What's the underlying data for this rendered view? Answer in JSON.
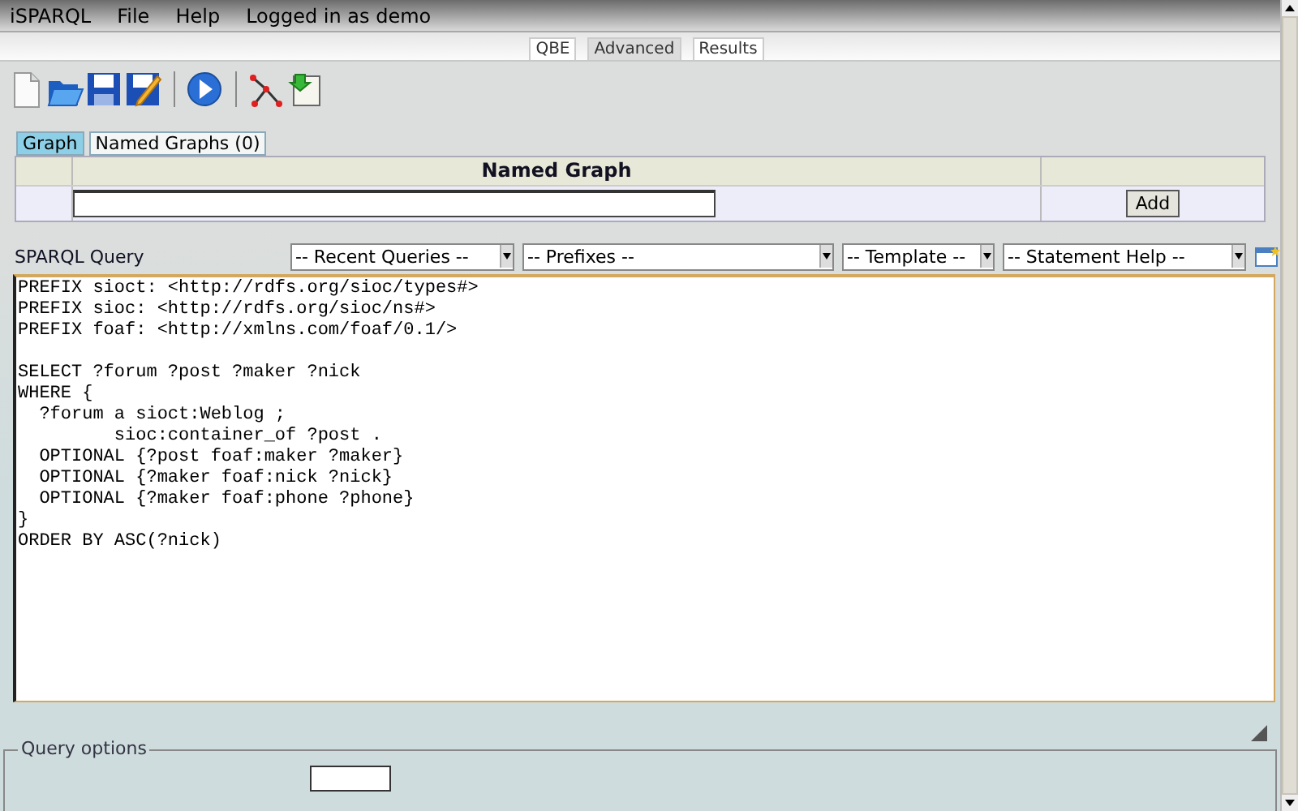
{
  "menu_bar": [
    "iSPARQL",
    "File",
    "Help",
    "Logged in as demo"
  ],
  "view_tabs": [
    {
      "label": "QBE",
      "selected": false
    },
    {
      "label": "Advanced",
      "selected": true
    },
    {
      "label": "Results",
      "selected": false
    }
  ],
  "toolbar": [
    {
      "kind": "new"
    },
    {
      "kind": "open"
    },
    {
      "kind": "save"
    },
    {
      "kind": "save-as"
    },
    {
      "kind": "sep"
    },
    {
      "kind": "run"
    },
    {
      "kind": "sep"
    },
    {
      "kind": "graph"
    },
    {
      "kind": "import"
    }
  ],
  "graph_tabs": [
    {
      "label": "Graph",
      "selected": true
    },
    {
      "label": "Named Graphs (0)",
      "selected": false
    }
  ],
  "named_graph_table": {
    "column": "Named Graph",
    "button": "Add"
  },
  "query": {
    "label": "SPARQL Query",
    "dropdowns": [
      "-- Recent Queries --",
      "-- Prefixes --",
      "-- Template --",
      "-- Statement Help --"
    ],
    "text": "PREFIX sioct: <http://rdfs.org/sioc/types#>\nPREFIX sioc: <http://rdfs.org/sioc/ns#>\nPREFIX foaf: <http://xmlns.com/foaf/0.1/>\n\nSELECT ?forum ?post ?maker ?nick\nWHERE {\n  ?forum a sioct:Weblog ;\n         sioc:container_of ?post .\n  OPTIONAL {?post foaf:maker ?maker}\n  OPTIONAL {?maker foaf:nick ?nick}\n  OPTIONAL {?maker foaf:phone ?phone}\n}\nORDER BY ASC(?nick)"
  },
  "query_options": {
    "legend": "Query options"
  }
}
